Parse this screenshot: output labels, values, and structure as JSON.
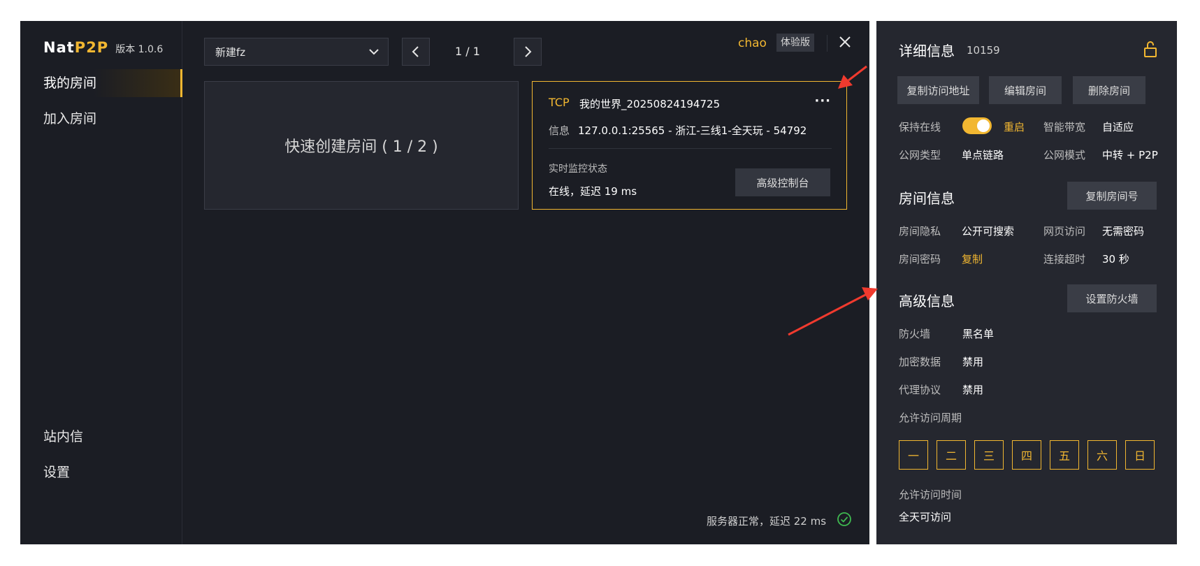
{
  "sidebar": {
    "brand_nat": "Nat",
    "brand_p2p": "P2P",
    "version": "版本 1.0.6",
    "items": [
      {
        "label": "我的房间"
      },
      {
        "label": "加入房间"
      },
      {
        "label": "站内信"
      },
      {
        "label": "设置"
      }
    ]
  },
  "toolbar": {
    "room_select": "新建fz",
    "page": "1 / 1",
    "username": "chao",
    "badge": "体验版"
  },
  "quick_create": {
    "label": "快速创建房间 ( 1 / 2 )"
  },
  "room_card": {
    "protocol": "TCP",
    "name": "我的世界_20250824194725",
    "more": "···",
    "info_label": "信息",
    "info_value": "127.0.0.1:25565 - 浙江-三线1-全天玩 - 54792",
    "monitor_label": "实时监控状态",
    "monitor_value": "在线，延迟 19 ms",
    "console_button": "高级控制台"
  },
  "status_bar": {
    "text": "服务器正常，延迟 22 ms"
  },
  "detail": {
    "title": "详细信息",
    "id": "10159",
    "buttons": {
      "copy_addr": "复制访问地址",
      "edit": "编辑房间",
      "delete": "删除房间"
    },
    "keep_online": {
      "label": "保持在线",
      "restart": "重启"
    },
    "smart_bw": {
      "label": "智能带宽",
      "value": "自适应"
    },
    "net_type": {
      "label": "公网类型",
      "value": "单点链路"
    },
    "net_mode": {
      "label": "公网模式",
      "value": "中转 + P2P"
    }
  },
  "room_info": {
    "title": "房间信息",
    "copy_button": "复制房间号",
    "privacy": {
      "label": "房间隐私",
      "value": "公开可搜索"
    },
    "web_access": {
      "label": "网页访问",
      "value": "无需密码"
    },
    "password": {
      "label": "房间密码",
      "value": "复制"
    },
    "timeout": {
      "label": "连接超时",
      "value": "30 秒"
    }
  },
  "advanced": {
    "title": "高级信息",
    "firewall_button": "设置防火墙",
    "firewall": {
      "label": "防火墙",
      "value": "黑名单"
    },
    "encrypt": {
      "label": "加密数据",
      "value": "禁用"
    },
    "proxy": {
      "label": "代理协议",
      "value": "禁用"
    },
    "period_label": "允许访问周期",
    "days": [
      "一",
      "二",
      "三",
      "四",
      "五",
      "六",
      "日"
    ],
    "time_label": "允许访问时间",
    "time_value": "全天可访问"
  },
  "colors": {
    "accent": "#f2b731",
    "bg": "#1b1d24",
    "panel": "#25272f",
    "arrow": "#f03a2e",
    "ok": "#3fb950"
  }
}
